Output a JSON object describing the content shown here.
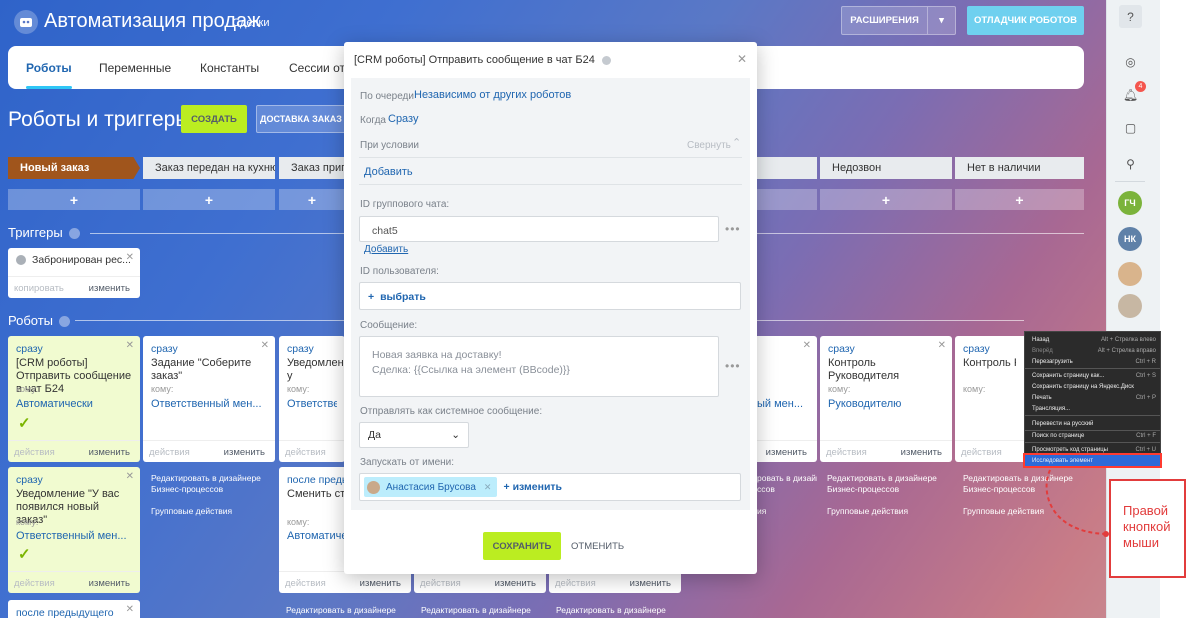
{
  "header": {
    "title": "Автоматизация продаж",
    "subtitle": "Сделки",
    "extensions_label": "РАСШИРЕНИЯ",
    "debugger_label": "ОТЛАДЧИК РОБОТОВ"
  },
  "tabs": [
    "Роботы",
    "Переменные",
    "Константы",
    "Сессии отл"
  ],
  "page_title": "Роботы и триггеры",
  "create_label": "СОЗДАТЬ",
  "delivery_label": "ДОСТАВКА ЗАКАЗ",
  "stages": [
    "Новый заказ",
    "Заказ передан на кухню",
    "Заказ пригот",
    "Недозвон",
    "Нет в наличии"
  ],
  "plus": "+",
  "triggers_label": "Триггеры",
  "trigger_card": {
    "name": "Забронирован рес...",
    "copy": "копировать",
    "edit": "изменить"
  },
  "robots_label": "Роботы",
  "robots": [
    {
      "when": "сразу",
      "name": "[CRM роботы] Отправить сообщение в чат Б24",
      "to_label": "кому:",
      "to": "Автоматически",
      "footer_left": "действия",
      "footer_right": "изменить"
    },
    {
      "when": "сразу",
      "name": "Задание \"Соберите заказ\"",
      "to_label": "кому:",
      "to": "Ответственный мен...",
      "footer_left": "действия",
      "footer_right": "изменить"
    },
    {
      "when": "сразу",
      "name": "Уведомлени Мы почти у",
      "to_label": "кому:",
      "to": "Ответственн",
      "footer_left": "действия",
      "footer_right": ""
    },
    {
      "when": "",
      "name": "",
      "to_label": "",
      "to": "ый мен...",
      "footer_left": "",
      "footer_right": "изменить"
    },
    {
      "when": "сразу",
      "name": "Контроль Руководителя",
      "to_label": "кому:",
      "to": "Руководителю",
      "footer_left": "действия",
      "footer_right": "изменить"
    },
    {
      "when": "сразу",
      "name": "Контроль Рук",
      "to_label": "кому:",
      "to": "",
      "footer_left": "действия",
      "footer_right": ""
    }
  ],
  "robots_row2": [
    {
      "when": "сразу",
      "name": "Уведомление \"У вас появился новый заказ\"",
      "to_label": "кому:",
      "to": "Ответственный мен...",
      "footer_left": "действия",
      "footer_right": "изменить"
    },
    {
      "when": "после предыд",
      "name": "Сменить стад",
      "to_label": "кому:",
      "to": "Автоматичес",
      "footer_left": "действия",
      "footer_right": "изменить"
    }
  ],
  "row3_when": "после предыдущего",
  "designer_link": "Редактировать в дизайнере Бизнес-процессов",
  "designer_link_short": "Редактировать в дизайнере",
  "group_actions": "Групповые действия",
  "footer_left_generic": "действия",
  "footer_right_generic": "изменить",
  "modal": {
    "title": "[CRM роботы] Отправить сообщение в чат Б24",
    "queue_label": "По очереди",
    "queue_value": "Независимо от других роботов",
    "when_label": "Когда",
    "when_value": "Сразу",
    "condition_label": "При условии",
    "collapse": "Свернуть",
    "add": "Добавить",
    "chat_id_label": "ID группового чата:",
    "chat_id_value": "chat5",
    "add2": "Добавить",
    "user_id_label": "ID пользователя:",
    "select_label": "выбрать",
    "message_label": "Сообщение:",
    "message_value": "Новая заявка на доставку!\nСделка: {{Ссылка на элемент (BBcode)}}",
    "system_label": "Отправлять как системное сообщение:",
    "system_value": "Да",
    "run_as_label": "Запускать от имени:",
    "run_as_user": "Анастасия Брусова",
    "change": "изменить",
    "save": "СОХРАНИТЬ",
    "cancel": "ОТМЕНИТЬ"
  },
  "sidebar": {
    "notifications_count": "4",
    "avatars": [
      "ГЧ",
      "НК"
    ]
  },
  "context_menu": [
    {
      "label": "Назад",
      "shortcut": "Alt + Стрелка влево"
    },
    {
      "label": "Вперёд",
      "shortcut": "Alt + Стрелка вправо",
      "disabled": true
    },
    {
      "label": "Перезагрузить",
      "shortcut": "Ctrl + R"
    },
    {
      "label": "Сохранить страницу как...",
      "shortcut": "Ctrl + S"
    },
    {
      "label": "Сохранить страницу на Яндекс.Диск",
      "shortcut": ""
    },
    {
      "label": "Печать",
      "shortcut": "Ctrl + P"
    },
    {
      "label": "Трансляция...",
      "shortcut": ""
    },
    {
      "label": "Перевести на русский",
      "shortcut": ""
    },
    {
      "label": "Поиск по странице",
      "shortcut": "Ctrl + F"
    },
    {
      "label": "Просмотреть код страницы",
      "shortcut": "Ctrl + U"
    },
    {
      "label": "Исследовать элемент",
      "shortcut": ""
    }
  ],
  "callout": "Правой кнопкой мыши",
  "colors": {
    "accent": "#2fc6f6",
    "save": "#bbed21",
    "stage_first": "#a0551c",
    "link": "#2066b0"
  }
}
